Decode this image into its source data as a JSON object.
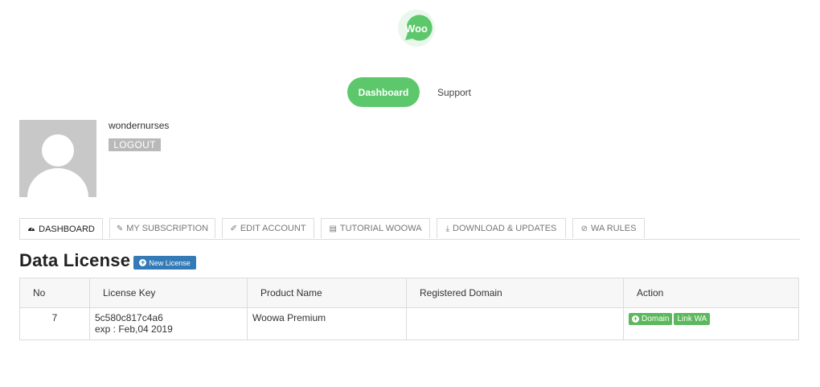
{
  "logo": {
    "text": "Woo",
    "color": "#5cc86b"
  },
  "nav": {
    "dashboard": "Dashboard",
    "support": "Support"
  },
  "profile": {
    "username": "wondernurses",
    "logout": "LOGOUT"
  },
  "tabs": [
    {
      "icon": "dashboard-icon",
      "label": "DASHBOARD"
    },
    {
      "icon": "pencil-icon",
      "label": "MY SUBSCRIPTION"
    },
    {
      "icon": "edit-icon",
      "label": "EDIT ACCOUNT"
    },
    {
      "icon": "book-icon",
      "label": "TUTORIAL WOOWA"
    },
    {
      "icon": "download-icon",
      "label": "DOWNLOAD & UPDATES"
    },
    {
      "icon": "ban-icon",
      "label": "WA RULES"
    }
  ],
  "section": {
    "title": "Data License",
    "new_license": "New License"
  },
  "table": {
    "headers": [
      "No",
      "License Key",
      "Product Name",
      "Registered Domain",
      "Action"
    ],
    "rows": [
      {
        "no": "7",
        "license_key": "5c580c817c4a6",
        "expiry": "exp : Feb,04 2019",
        "product": "Woowa Premium",
        "domain": "",
        "actions": {
          "domain": "Domain",
          "link": "Link WA"
        }
      }
    ]
  },
  "colors": {
    "accent": "#5cc86b",
    "primary": "#337ab7",
    "success": "#5cb85c"
  }
}
